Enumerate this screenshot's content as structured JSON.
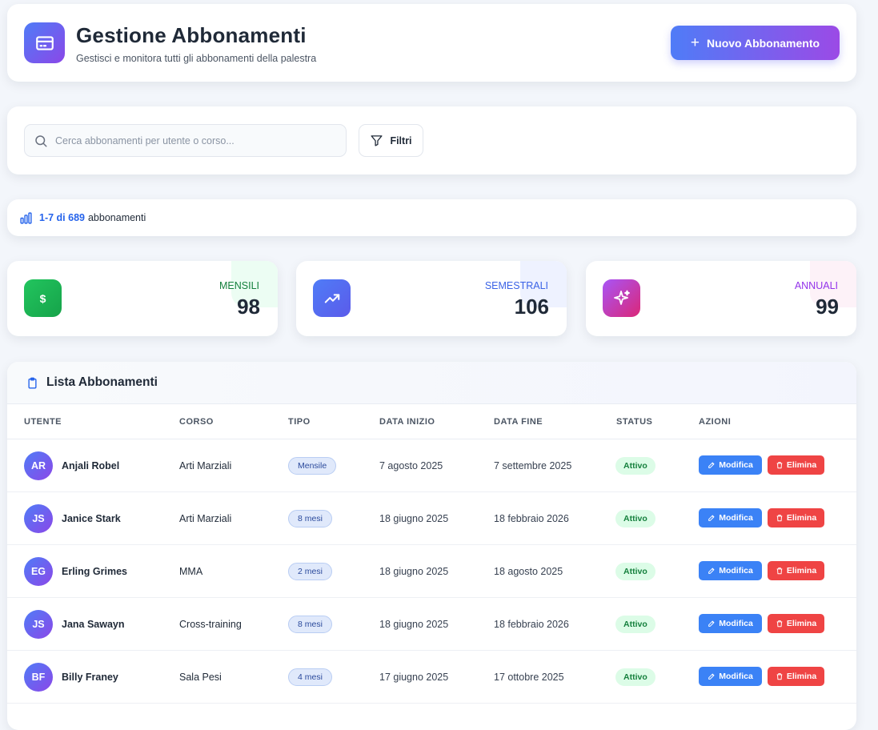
{
  "header": {
    "title": "Gestione Abbonamenti",
    "subtitle": "Gestisci e monitora tutti gli abbonamenti della palestra",
    "icon": "credit-card-icon",
    "new_button_label": "Nuovo Abbonamento"
  },
  "search": {
    "placeholder": "Cerca abbonamenti per utente o corso...",
    "value": "",
    "filter_label": "Filtri"
  },
  "count": {
    "range": "1-7 di 689",
    "suffix": "abbonamenti"
  },
  "stats": [
    {
      "label": "MENSILI",
      "value": "98",
      "icon": "dollar-icon",
      "symbol": "$",
      "color": "#16a34a"
    },
    {
      "label": "SEMESTRALI",
      "value": "106",
      "icon": "trending-up-icon",
      "color": "#3b63e6"
    },
    {
      "label": "ANNUALI",
      "value": "99",
      "icon": "sparkles-icon",
      "color": "#9333ea"
    }
  ],
  "table": {
    "title": "Lista Abbonamenti",
    "columns": [
      "UTENTE",
      "CORSO",
      "TIPO",
      "DATA INIZIO",
      "DATA FINE",
      "STATUS",
      "AZIONI"
    ],
    "edit_label": "Modifica",
    "delete_label": "Elimina",
    "rows": [
      {
        "initials": "AR",
        "name": "Anjali Robel",
        "course": "Arti Marziali",
        "type": "Mensile",
        "start": "7 agosto 2025",
        "end": "7 settembre 2025",
        "status": "Attivo"
      },
      {
        "initials": "JS",
        "name": "Janice Stark",
        "course": "Arti Marziali",
        "type": "8 mesi",
        "start": "18 giugno 2025",
        "end": "18 febbraio 2026",
        "status": "Attivo"
      },
      {
        "initials": "EG",
        "name": "Erling Grimes",
        "course": "MMA",
        "type": "2 mesi",
        "start": "18 giugno 2025",
        "end": "18 agosto 2025",
        "status": "Attivo"
      },
      {
        "initials": "JS",
        "name": "Jana Sawayn",
        "course": "Cross-training",
        "type": "8 mesi",
        "start": "18 giugno 2025",
        "end": "18 febbraio 2026",
        "status": "Attivo"
      },
      {
        "initials": "BF",
        "name": "Billy Franey",
        "course": "Sala Pesi",
        "type": "4 mesi",
        "start": "17 giugno 2025",
        "end": "17 ottobre 2025",
        "status": "Attivo"
      }
    ]
  },
  "colors": {
    "accent": "#4f7cf7",
    "accent_purple": "#8b47e8",
    "link_blue": "#2563eb",
    "edit_blue": "#3b82f6",
    "delete_red": "#ef4444",
    "status_green": "#15803d"
  }
}
